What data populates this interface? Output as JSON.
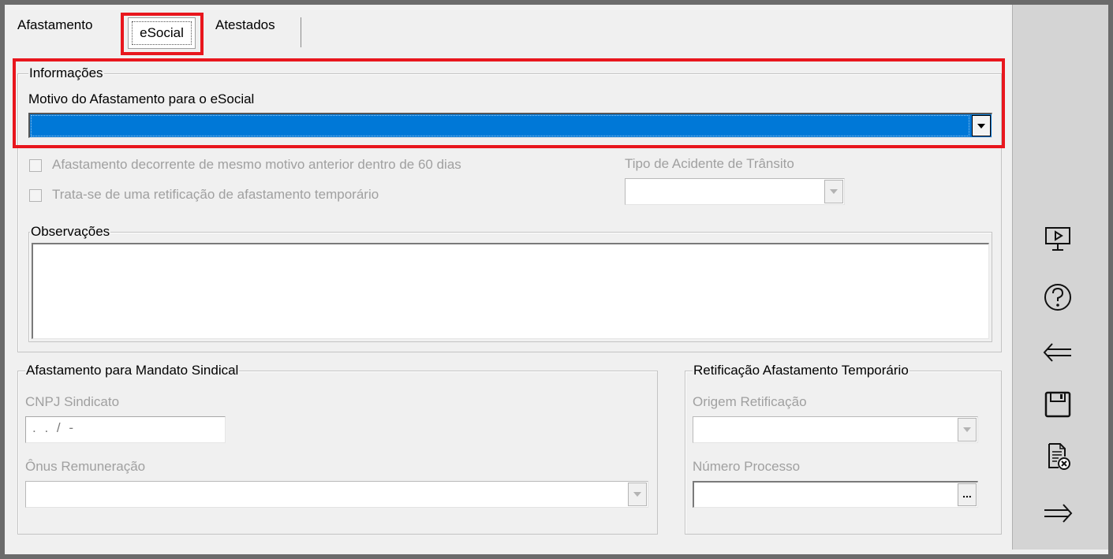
{
  "tabs": [
    {
      "label": "Afastamento"
    },
    {
      "label": "eSocial",
      "selected": true
    },
    {
      "label": "Atestados"
    }
  ],
  "informacoes": {
    "title": "Informações",
    "motivo_label": "Motivo do Afastamento para o eSocial",
    "motivo_value": "",
    "selected_color": "#0078d7"
  },
  "checkboxes": [
    {
      "label": "Afastamento decorrente de mesmo motivo anterior dentro de 60 dias",
      "checked": false
    },
    {
      "label": "Trata-se de uma retificação de afastamento temporário",
      "checked": false
    }
  ],
  "tipo_acidente": {
    "label": "Tipo de Acidente de Trânsito",
    "value": ""
  },
  "observacoes": {
    "title": "Observações",
    "value": ""
  },
  "mandato": {
    "title": "Afastamento para Mandato Sindical",
    "cnpj_label": "CNPJ Sindicato",
    "cnpj_mask": ". . /  -",
    "onus_label": "Ônus Remuneração",
    "onus_value": ""
  },
  "retificacao": {
    "title": "Retificação Afastamento Temporário",
    "origem_label": "Origem Retificação",
    "origem_value": "",
    "numero_label": "Número Processo",
    "numero_value": "",
    "ellipsis": "..."
  },
  "sidebar_icons": [
    "presentation-screen-icon",
    "help-icon",
    "back-arrow-icon",
    "save-icon",
    "cancel-document-icon",
    "forward-arrow-icon"
  ],
  "colors": {
    "highlight": "#e8161d",
    "selection": "#0078d7"
  }
}
